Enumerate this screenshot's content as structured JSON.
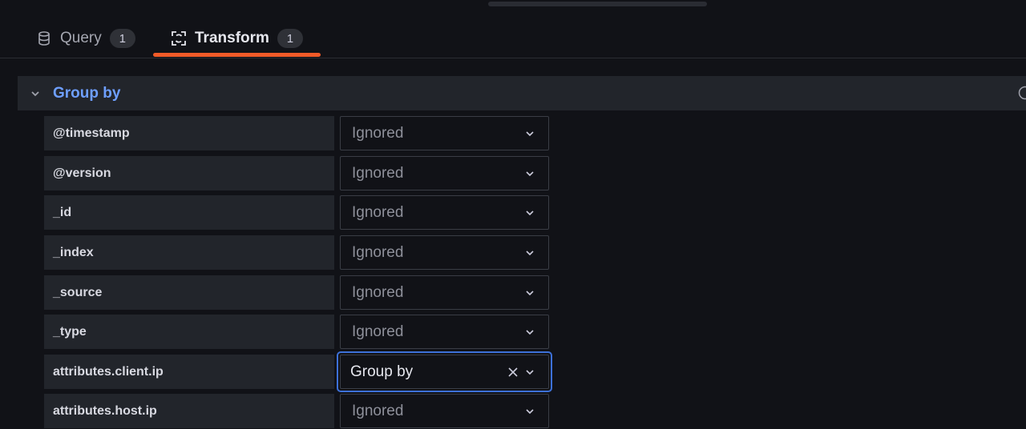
{
  "tabs": [
    {
      "label": "Query",
      "count": "1",
      "icon": "database-icon",
      "active": false
    },
    {
      "label": "Transform",
      "count": "1",
      "icon": "transform-icon",
      "active": true
    }
  ],
  "group": {
    "title": "Group by",
    "fields": [
      {
        "name": "@timestamp",
        "value": "Ignored"
      },
      {
        "name": "@version",
        "value": "Ignored"
      },
      {
        "name": "_id",
        "value": "Ignored"
      },
      {
        "name": "_index",
        "value": "Ignored"
      },
      {
        "name": "_source",
        "value": "Ignored"
      },
      {
        "name": "_type",
        "value": "Ignored"
      },
      {
        "name": "attributes.client.ip",
        "value": "Group by"
      },
      {
        "name": "attributes.host.ip",
        "value": "Ignored"
      }
    ]
  },
  "colors": {
    "accent_tab": "#f05a28",
    "group_title": "#6e9fff",
    "focus_border": "#3d71d9"
  }
}
